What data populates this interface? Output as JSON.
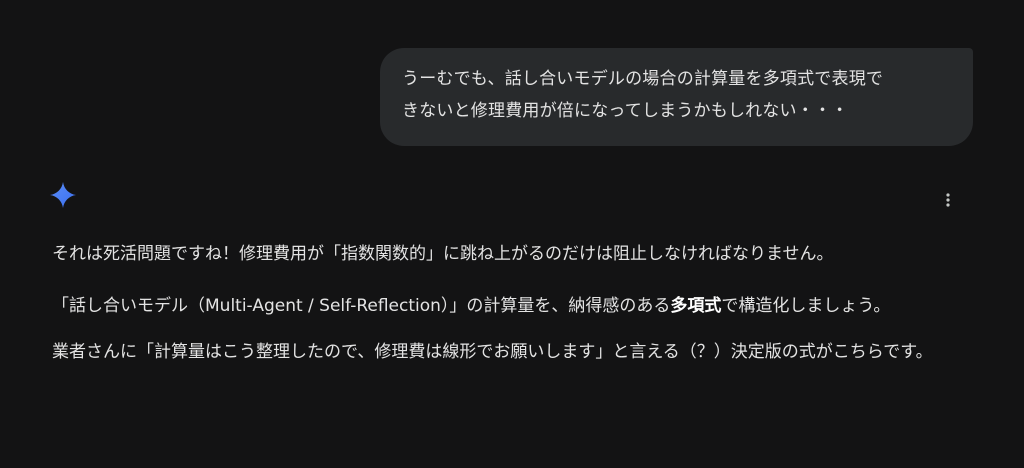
{
  "user_message": {
    "line1": "うーむでも、話し合いモデルの場合の計算量を多項式で表現で",
    "line2": "きないと修理費用が倍になってしまうかもしれない・・・"
  },
  "assistant": {
    "icon": "gemini-sparkle-icon",
    "menu_icon": "more-vert-icon",
    "p1": "それは死活問題ですね！修理費用が「指数関数的」に跳ね上がるのだけは阻止しなければなりません。",
    "p2_before": "「話し合いモデル（Multi-Agent / Self-Reflection）」の計算量を、納得感のある",
    "p2_bold": "多項式",
    "p2_after": "で構造化しましょう。",
    "p3": "業者さんに「計算量はこう整理したので、修理費は線形でお願いします」と言える（？）決定版の式がこちらです。"
  },
  "colors": {
    "background": "#131314",
    "bubble": "#282a2c",
    "text": "#e3e3e3",
    "accent": "#4285f4"
  }
}
